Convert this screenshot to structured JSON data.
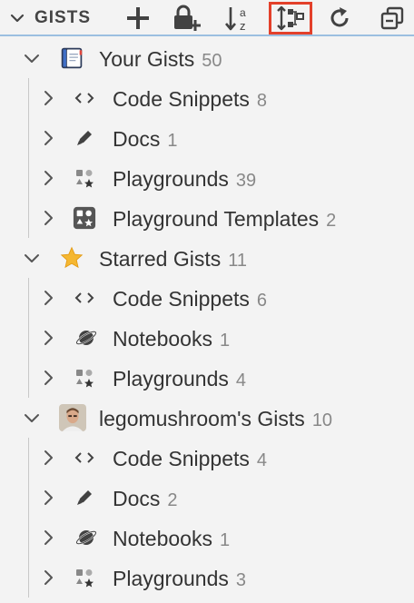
{
  "header": {
    "title": "GISTS",
    "actions": [
      {
        "name": "new-gist-button",
        "icon": "plus-icon"
      },
      {
        "name": "new-secret-gist-button",
        "icon": "lock-plus-icon"
      },
      {
        "name": "sort-button",
        "icon": "sort-a-z-icon"
      },
      {
        "name": "group-button",
        "icon": "group-tree-icon",
        "highlighted": true
      },
      {
        "name": "refresh-button",
        "icon": "refresh-icon"
      },
      {
        "name": "collapse-all-button",
        "icon": "collapse-all-icon"
      }
    ]
  },
  "tree": [
    {
      "label": "Your Gists",
      "count": "50",
      "icon": "notebook-icon",
      "children": [
        {
          "label": "Code Snippets",
          "count": "8",
          "icon": "code-icon"
        },
        {
          "label": "Docs",
          "count": "1",
          "icon": "pencil-icon"
        },
        {
          "label": "Playgrounds",
          "count": "39",
          "icon": "playground-icon"
        },
        {
          "label": "Playground Templates",
          "count": "2",
          "icon": "playground-template-icon"
        }
      ]
    },
    {
      "label": "Starred Gists",
      "count": "11",
      "icon": "star-icon",
      "children": [
        {
          "label": "Code Snippets",
          "count": "6",
          "icon": "code-icon"
        },
        {
          "label": "Notebooks",
          "count": "1",
          "icon": "planet-icon"
        },
        {
          "label": "Playgrounds",
          "count": "4",
          "icon": "playground-icon"
        }
      ]
    },
    {
      "label": "legomushroom's Gists",
      "count": "10",
      "icon": "avatar",
      "children": [
        {
          "label": "Code Snippets",
          "count": "4",
          "icon": "code-icon"
        },
        {
          "label": "Docs",
          "count": "2",
          "icon": "pencil-icon"
        },
        {
          "label": "Notebooks",
          "count": "1",
          "icon": "planet-icon"
        },
        {
          "label": "Playgrounds",
          "count": "3",
          "icon": "playground-icon"
        }
      ]
    }
  ],
  "colors": {
    "highlight_border": "#e3402a",
    "star": "#f5b731",
    "header_divider": "#9bbfe0"
  }
}
